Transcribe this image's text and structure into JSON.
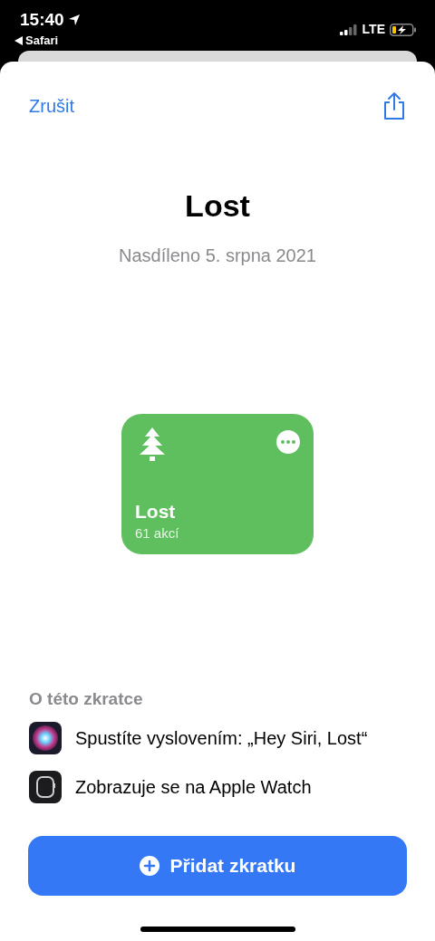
{
  "status_bar": {
    "time": "15:40",
    "back_app": "Safari",
    "network": "LTE"
  },
  "nav": {
    "cancel": "Zrušit"
  },
  "title": "Lost",
  "subtitle": "Nasdíleno 5. srpna 2021",
  "shortcut_card": {
    "name": "Lost",
    "actions": "61 akcí",
    "color": "#5fbf5f"
  },
  "about": {
    "heading": "O této zkratce",
    "items": [
      {
        "kind": "siri",
        "text": "Spustíte vyslovením: „Hey Siri, Lost“"
      },
      {
        "kind": "watch",
        "text": "Zobrazuje se na Apple Watch"
      }
    ]
  },
  "add_button": {
    "label": "Přidat zkratku"
  }
}
